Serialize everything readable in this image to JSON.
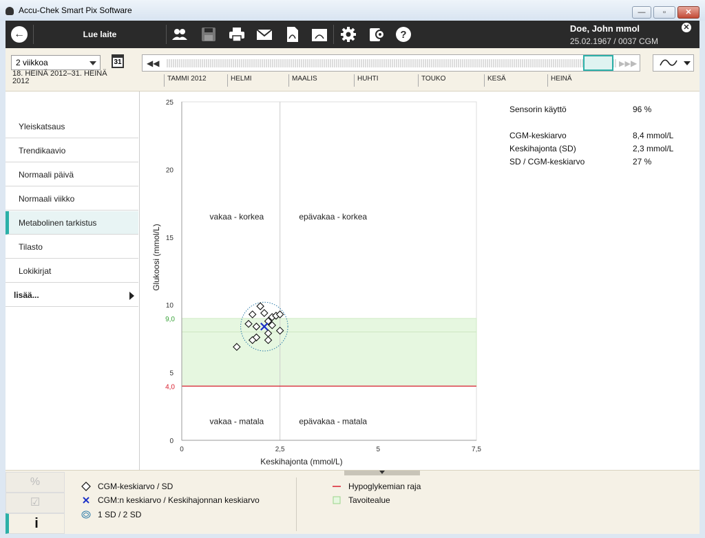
{
  "window": {
    "title": "Accu-Chek Smart Pix Software",
    "min": "—",
    "max": "▫",
    "close": "✕"
  },
  "toolbar": {
    "read_device": "Lue laite"
  },
  "user": {
    "name": "Doe, John mmol",
    "dob_info": "25.02.1967 / 0037 CGM"
  },
  "filter": {
    "period": "2 viikkoa",
    "calendar_day": "31",
    "range": "18. HEINÄ 2012–31. HEINÄ 2012",
    "months": [
      "TAMMI 2012",
      "HELMI",
      "MAALIS",
      "HUHTI",
      "TOUKO",
      "KESÄ",
      "HEINÄ"
    ]
  },
  "sidebar": {
    "items": [
      {
        "label": "Yleiskatsaus"
      },
      {
        "label": "Trendikaavio"
      },
      {
        "label": "Normaali päivä"
      },
      {
        "label": "Normaali viikko"
      },
      {
        "label": "Metabolinen tarkistus"
      },
      {
        "label": "Tilasto"
      },
      {
        "label": "Lokikirjat"
      }
    ],
    "more": "lisää..."
  },
  "chart_data": {
    "type": "scatter",
    "xlabel": "Keskihajonta (mmol/L)",
    "ylabel": "Glukoosi (mmol/L)",
    "xlim": [
      0,
      7.5
    ],
    "ylim": [
      0,
      25
    ],
    "xticks": [
      "0",
      "2,5",
      "5",
      "7,5"
    ],
    "yticks": [
      "0",
      "5",
      "10",
      "15",
      "20",
      "25"
    ],
    "target_range": [
      4.0,
      9.0
    ],
    "target_labels": {
      "upper": "9,0",
      "lower": "4,0"
    },
    "hypo_limit": 4.0,
    "quadrants": [
      "vakaa - korkea",
      "epävakaa - korkea",
      "vakaa - matala",
      "epävakaa - matala"
    ],
    "points": [
      [
        2.0,
        9.9
      ],
      [
        1.8,
        9.3
      ],
      [
        2.1,
        9.4
      ],
      [
        2.3,
        9.1
      ],
      [
        2.4,
        9.2
      ],
      [
        2.5,
        9.3
      ],
      [
        1.7,
        8.6
      ],
      [
        2.2,
        8.8
      ],
      [
        1.9,
        8.4
      ],
      [
        2.3,
        8.5
      ],
      [
        1.9,
        7.6
      ],
      [
        2.2,
        7.9
      ],
      [
        2.5,
        8.1
      ],
      [
        1.8,
        7.4
      ],
      [
        2.2,
        7.4
      ],
      [
        1.4,
        6.9
      ]
    ],
    "mean_point": [
      2.1,
      8.4
    ],
    "sd_ellipse": {
      "cx": 2.1,
      "cy": 8.4,
      "rx": 0.6,
      "ry": 1.8
    },
    "colors": {
      "target": "#e6f7e0",
      "hypo": "#d81e2e",
      "mean": "#1a2fc7",
      "ellipse": "#2a7aa8",
      "target_label": "#3aa33a"
    }
  },
  "stats": [
    {
      "label": "Sensorin käyttö",
      "value": "96 %"
    },
    {
      "label": "CGM-keskiarvo",
      "value": "8,4 mmol/L"
    },
    {
      "label": "Keskihajonta (SD)",
      "value": "2,3 mmol/L"
    },
    {
      "label": "SD / CGM-keskiarvo",
      "value": "27 %"
    }
  ],
  "legend": {
    "points": "CGM-keskiarvo / SD",
    "mean": "CGM:n keskiarvo / Keskihajonnan keskiarvo",
    "sd": "1 SD / 2 SD",
    "hypo": "Hypoglykemian raja",
    "target": "Tavoitealue"
  },
  "bottom_tabs": {
    "percent": "%",
    "check": "☑",
    "info": "i"
  }
}
